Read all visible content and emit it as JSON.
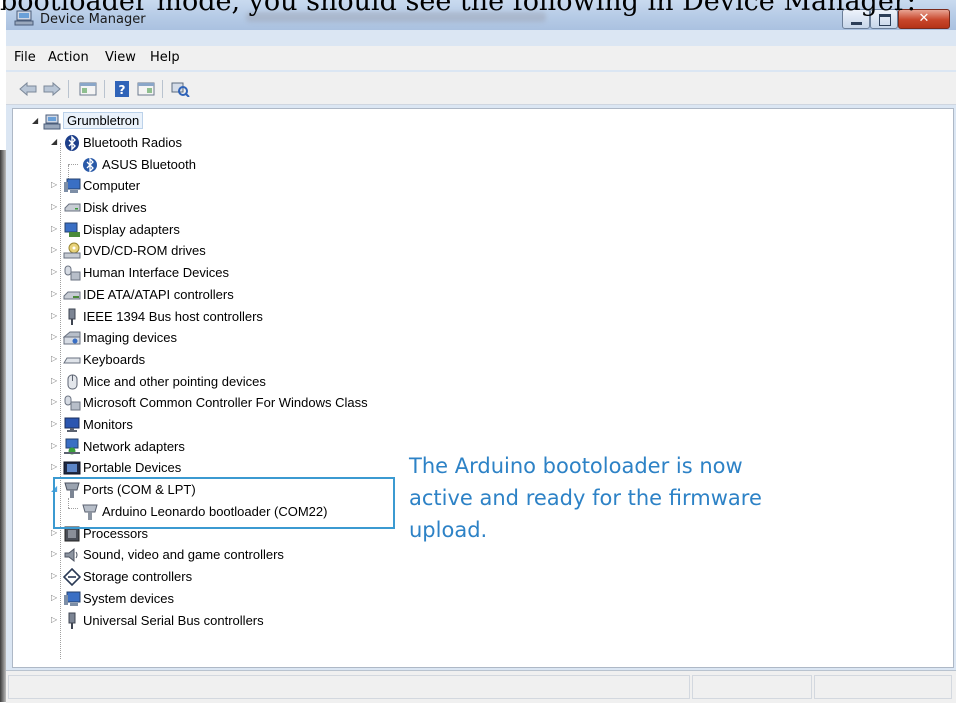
{
  "page_caption": "bootloader mode, you should see the following in Device Manager:",
  "window": {
    "title": "Device Manager"
  },
  "menu": {
    "file": "File",
    "action": "Action",
    "view": "View",
    "help": "Help"
  },
  "toolbar": {
    "icons": [
      "back-icon",
      "forward-icon",
      "console-icon",
      "help-icon",
      "properties-icon",
      "scan-hardware-icon"
    ]
  },
  "tree": {
    "root": "Grumbletron",
    "bluetooth": "Bluetooth Radios",
    "asus": "ASUS Bluetooth",
    "computer": "Computer",
    "disk": "Disk drives",
    "display": "Display adapters",
    "dvd": "DVD/CD-ROM drives",
    "hid": "Human Interface Devices",
    "ide": "IDE ATA/ATAPI controllers",
    "ieee": "IEEE 1394 Bus host controllers",
    "imaging": "Imaging devices",
    "keyboards": "Keyboards",
    "mice": "Mice and other pointing devices",
    "mscc": "Microsoft Common Controller For Windows Class",
    "monitors": "Monitors",
    "network": "Network adapters",
    "portable": "Portable Devices",
    "ports": "Ports (COM & LPT)",
    "arduino": "Arduino Leonardo bootloader (COM22)",
    "processors": "Processors",
    "sound": "Sound, video and game controllers",
    "storage": "Storage controllers",
    "system": "System devices",
    "usb": "Universal Serial Bus controllers"
  },
  "annotation": {
    "line1": "The Arduino bootoloader is now",
    "line2": "active and ready for the firmware",
    "line3": "upload."
  },
  "colors": {
    "annotation": "#2d82c6",
    "highlight_border": "#3b9ad1",
    "close_button": "#c8462b"
  }
}
